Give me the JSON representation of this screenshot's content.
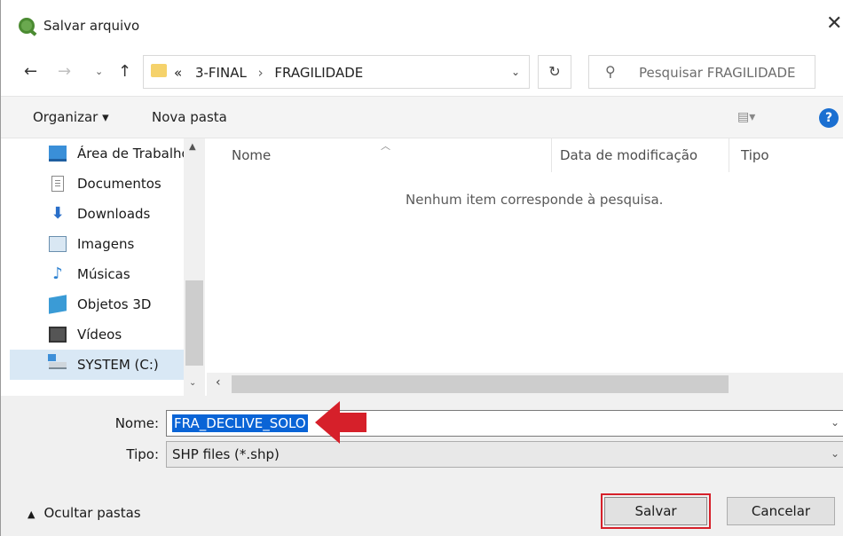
{
  "window": {
    "title": "Salvar arquivo",
    "close_glyph": "✕"
  },
  "nav": {
    "back_glyph": "←",
    "forward_glyph": "→",
    "recent_glyph": "⌄",
    "up_glyph": "↑",
    "breadcrumb": {
      "overflow": "«",
      "items": [
        "3-FINAL",
        "FRAGILIDADE"
      ],
      "separator": "›"
    },
    "refresh_glyph": "↻",
    "search_placeholder": "Pesquisar FRAGILIDADE"
  },
  "toolbar": {
    "organize_label": "Organizar ▾",
    "new_folder_label": "Nova pasta",
    "view_glyph": "▤▾",
    "help_glyph": "?"
  },
  "sidebar": {
    "items": [
      {
        "label": "Área de Trabalho",
        "icon": "desktop-icon"
      },
      {
        "label": "Documentos",
        "icon": "documents-icon"
      },
      {
        "label": "Downloads",
        "icon": "downloads-icon"
      },
      {
        "label": "Imagens",
        "icon": "pictures-icon"
      },
      {
        "label": "Músicas",
        "icon": "music-icon"
      },
      {
        "label": "Objetos 3D",
        "icon": "objects-3d-icon"
      },
      {
        "label": "Vídeos",
        "icon": "videos-icon"
      },
      {
        "label": "SYSTEM (C:)",
        "icon": "drive-icon",
        "selected": true
      }
    ]
  },
  "file_list": {
    "columns": [
      "Nome",
      "Data de modificação",
      "Tipo"
    ],
    "empty_message": "Nenhum item corresponde à pesquisa."
  },
  "form": {
    "name_label": "Nome:",
    "name_value": "FRA_DECLIVE_SOLO",
    "type_label": "Tipo:",
    "type_value": "SHP files (*.shp)"
  },
  "footer": {
    "hide_folders_label": "Ocultar pastas",
    "save_label": "Salvar",
    "cancel_label": "Cancelar"
  },
  "colors": {
    "selection": "#0a64d6",
    "annotation_red": "#d6202a"
  }
}
